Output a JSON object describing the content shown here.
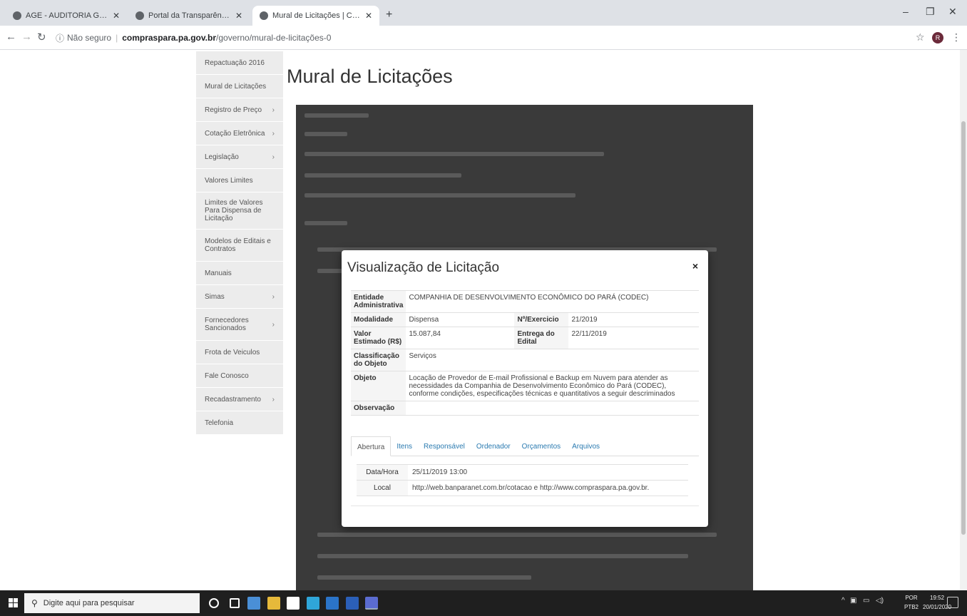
{
  "browser": {
    "tabs": [
      {
        "title": "AGE - AUDITORIA GERAL DO ES",
        "active": false
      },
      {
        "title": "Portal da Transparência",
        "active": false
      },
      {
        "title": "Mural de Licitações | Compras P",
        "active": true
      }
    ],
    "url": {
      "security": "Não seguro",
      "host": "compraspara.pa.gov.br",
      "path": "/governo/mural-de-licitações-0"
    },
    "profile_initial": "R"
  },
  "sidebar": {
    "items": [
      {
        "label": "Repactuação 2016",
        "has_arrow": false
      },
      {
        "label": "Mural de Licitações",
        "has_arrow": false
      },
      {
        "label": "Registro de Preço",
        "has_arrow": true
      },
      {
        "label": "Cotação Eletrônica",
        "has_arrow": true
      },
      {
        "label": "Legislação",
        "has_arrow": true
      },
      {
        "label": "Valores Limites",
        "has_arrow": false
      },
      {
        "label": "Limites de Valores Para Dispensa de Licitação",
        "has_arrow": false
      },
      {
        "label": "Modelos de Editais e Contratos",
        "has_arrow": false
      },
      {
        "label": "Manuais",
        "has_arrow": false
      },
      {
        "label": "Simas",
        "has_arrow": true
      },
      {
        "label": "Fornecedores Sancionados",
        "has_arrow": true
      },
      {
        "label": "Frota de Veiculos",
        "has_arrow": false
      },
      {
        "label": "Fale Conosco",
        "has_arrow": false
      },
      {
        "label": "Recadastramento",
        "has_arrow": true
      },
      {
        "label": "Telefonia",
        "has_arrow": false
      }
    ]
  },
  "page": {
    "title": "Mural de Licitações"
  },
  "modal": {
    "title": "Visualização de Licitação",
    "close": "×",
    "fields": {
      "entidade_label": "Entidade Administrativa",
      "entidade_value": "COMPANHIA DE DESENVOLVIMENTO ECONÔMICO DO PARÁ (CODEC)",
      "modalidade_label": "Modalidade",
      "modalidade_value": "Dispensa",
      "exercicio_label": "Nº/Exercicio",
      "exercicio_value": "21/2019",
      "valor_label": "Valor Estimado (R$)",
      "valor_value": "15.087,84",
      "entrega_label": "Entrega do Edital",
      "entrega_value": "22/11/2019",
      "classificacao_label": "Classificação do Objeto",
      "classificacao_value": "Serviços",
      "objeto_label": "Objeto",
      "objeto_value": "Locação de Provedor de E-mail Profissional e Backup em Nuvem para atender as necessidades da Companhia de Desenvolvimento Econômico do Pará (CODEC), conforme condições, especificações técnicas e quantitativos a seguir descriminados",
      "observacao_label": "Observação",
      "observacao_value": ""
    },
    "tabs": [
      "Abertura",
      "Itens",
      "Responsável",
      "Ordenador",
      "Orçamentos",
      "Arquivos"
    ],
    "active_tab": "Abertura",
    "abertura": {
      "datahora_label": "Data/Hora",
      "datahora_value": "25/11/2019 13:00",
      "local_label": "Local",
      "local_value": "http://web.banparanet.com.br/cotacao e http://www.compraspara.pa.gov.br."
    }
  },
  "taskbar": {
    "search_placeholder": "Digite aqui para pesquisar",
    "lang_line1": "POR",
    "lang_line2": "PTB2",
    "time": "19:52",
    "date": "20/01/2020"
  }
}
